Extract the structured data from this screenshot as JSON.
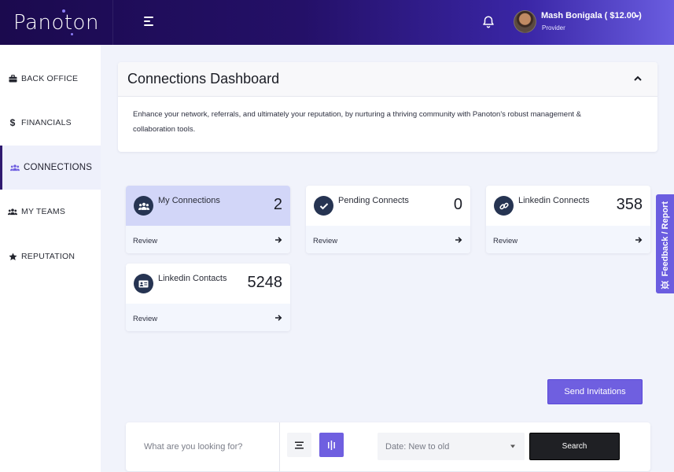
{
  "header": {
    "logo": "Panoton",
    "user_name": "Mash Bonigala ( $12.00 )",
    "user_role": "Provider"
  },
  "sidebar": {
    "items": [
      {
        "label": "BACK OFFICE",
        "icon": "briefcase-icon"
      },
      {
        "label": "FINANCIALS",
        "icon": "dollar-icon"
      },
      {
        "label": "CONNECTIONS",
        "icon": "users-icon",
        "active": true
      },
      {
        "label": "MY TEAMS",
        "icon": "team-icon"
      },
      {
        "label": "REPUTATION",
        "icon": "star-icon"
      }
    ]
  },
  "dashboard": {
    "title": "Connections Dashboard",
    "description": "Enhance your network, referrals, and ultimately your reputation, by nurturing a thriving community with Panoton's robust management & collaboration tools."
  },
  "cards": [
    {
      "title": "My Connections",
      "value": "2",
      "link": "Review",
      "icon": "users-icon",
      "highlight": true
    },
    {
      "title": "Pending Connects",
      "value": "0",
      "link": "Review",
      "icon": "check-icon"
    },
    {
      "title": "Linkedin Connects",
      "value": "358",
      "link": "Review",
      "icon": "link-icon"
    },
    {
      "title": "Linkedin Contacts",
      "value": "5248",
      "link": "Review",
      "icon": "contact-card-icon"
    }
  ],
  "actions": {
    "send_invitations": "Send Invitations"
  },
  "search": {
    "placeholder": "What are you looking for?",
    "sort_value": "Date: New to old",
    "search_label": "Search"
  },
  "feedback": {
    "label": "Feedback / Report"
  },
  "colors": {
    "accent": "#6f5fe0",
    "header_dark": "#1b0a4e",
    "card_icon_bg": "#263452",
    "card_highlight": "#d2d6f8"
  }
}
